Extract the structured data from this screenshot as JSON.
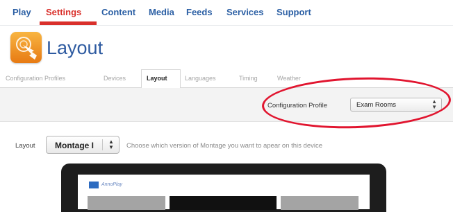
{
  "nav": {
    "items": [
      {
        "label": "Play",
        "active": false
      },
      {
        "label": "Settings",
        "active": true
      },
      {
        "label": "Content",
        "active": false
      },
      {
        "label": "Media",
        "active": false
      },
      {
        "label": "Feeds",
        "active": false
      },
      {
        "label": "Services",
        "active": false
      },
      {
        "label": "Support",
        "active": false
      }
    ],
    "active_color": "#d9302b",
    "link_color": "#2b5fa4"
  },
  "header": {
    "title": "Layout",
    "icon": "settings-hand-icon"
  },
  "subtabs": {
    "items": [
      {
        "label": "Configuration Profiles"
      },
      {
        "label": "Devices"
      },
      {
        "label": "Layout",
        "active": true
      },
      {
        "label": "Languages"
      },
      {
        "label": "Timing"
      },
      {
        "label": "Weather"
      }
    ]
  },
  "config_profile": {
    "label": "Configuration Profile",
    "selected": "Exam Rooms",
    "highlight_color": "#e1152f"
  },
  "layout_row": {
    "label": "Layout",
    "selected": "Montage I",
    "hint": "Choose which version of Montage you want to apear on this device"
  },
  "preview": {
    "brand": "AnnoPlay"
  }
}
